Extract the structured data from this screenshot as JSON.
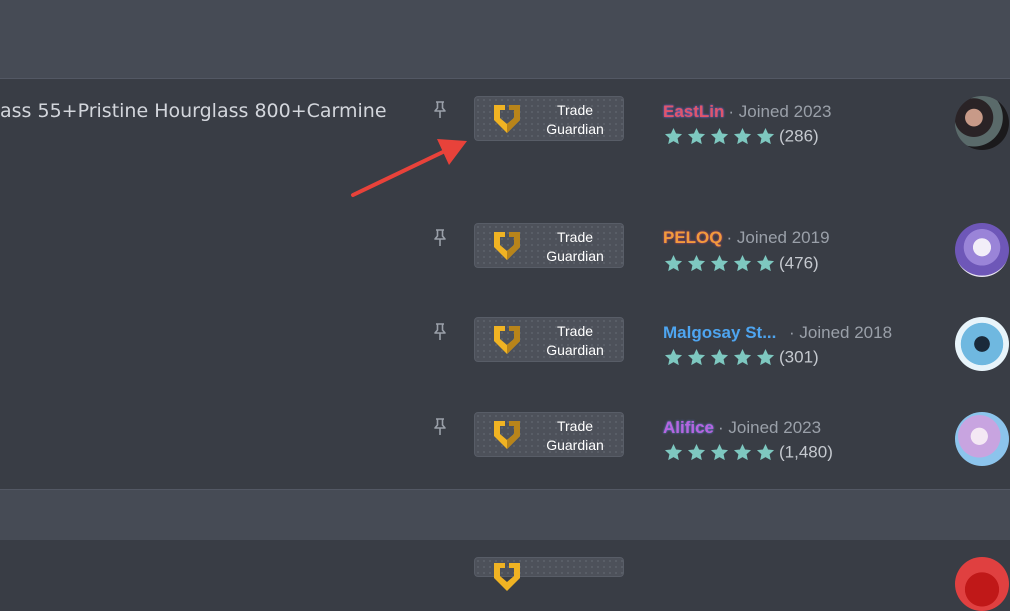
{
  "listing": {
    "title": "ass 55+Pristine Hourglass 800+Carmine"
  },
  "badge": {
    "line1": "Trade",
    "line2": "Guardian"
  },
  "sellers": [
    {
      "name": "EastLin",
      "joined": "· Joined 2023",
      "rating_count": "(286)",
      "name_color": "#e0556b",
      "stars": 5
    },
    {
      "name": "PELOQ",
      "joined": "· Joined 2019",
      "rating_count": "(476)",
      "name_color": "#f39a3c",
      "stars": 5
    },
    {
      "name": "Malgosay St...",
      "joined": "· Joined 2018",
      "rating_count": "(301)",
      "name_color": "#4ea5f0",
      "stars": 5
    },
    {
      "name": "Alifice",
      "joined": "· Joined 2023",
      "rating_count": "(1,480)",
      "name_color": "#b764e0",
      "stars": 5
    }
  ],
  "colors": {
    "star": "#7ec8c0",
    "shield": "#f0b323",
    "arrow": "#e8423a"
  },
  "icons": [
    "pin-icon",
    "trade-guardian-shield-icon",
    "star-icon",
    "annotation-arrow-icon"
  ]
}
